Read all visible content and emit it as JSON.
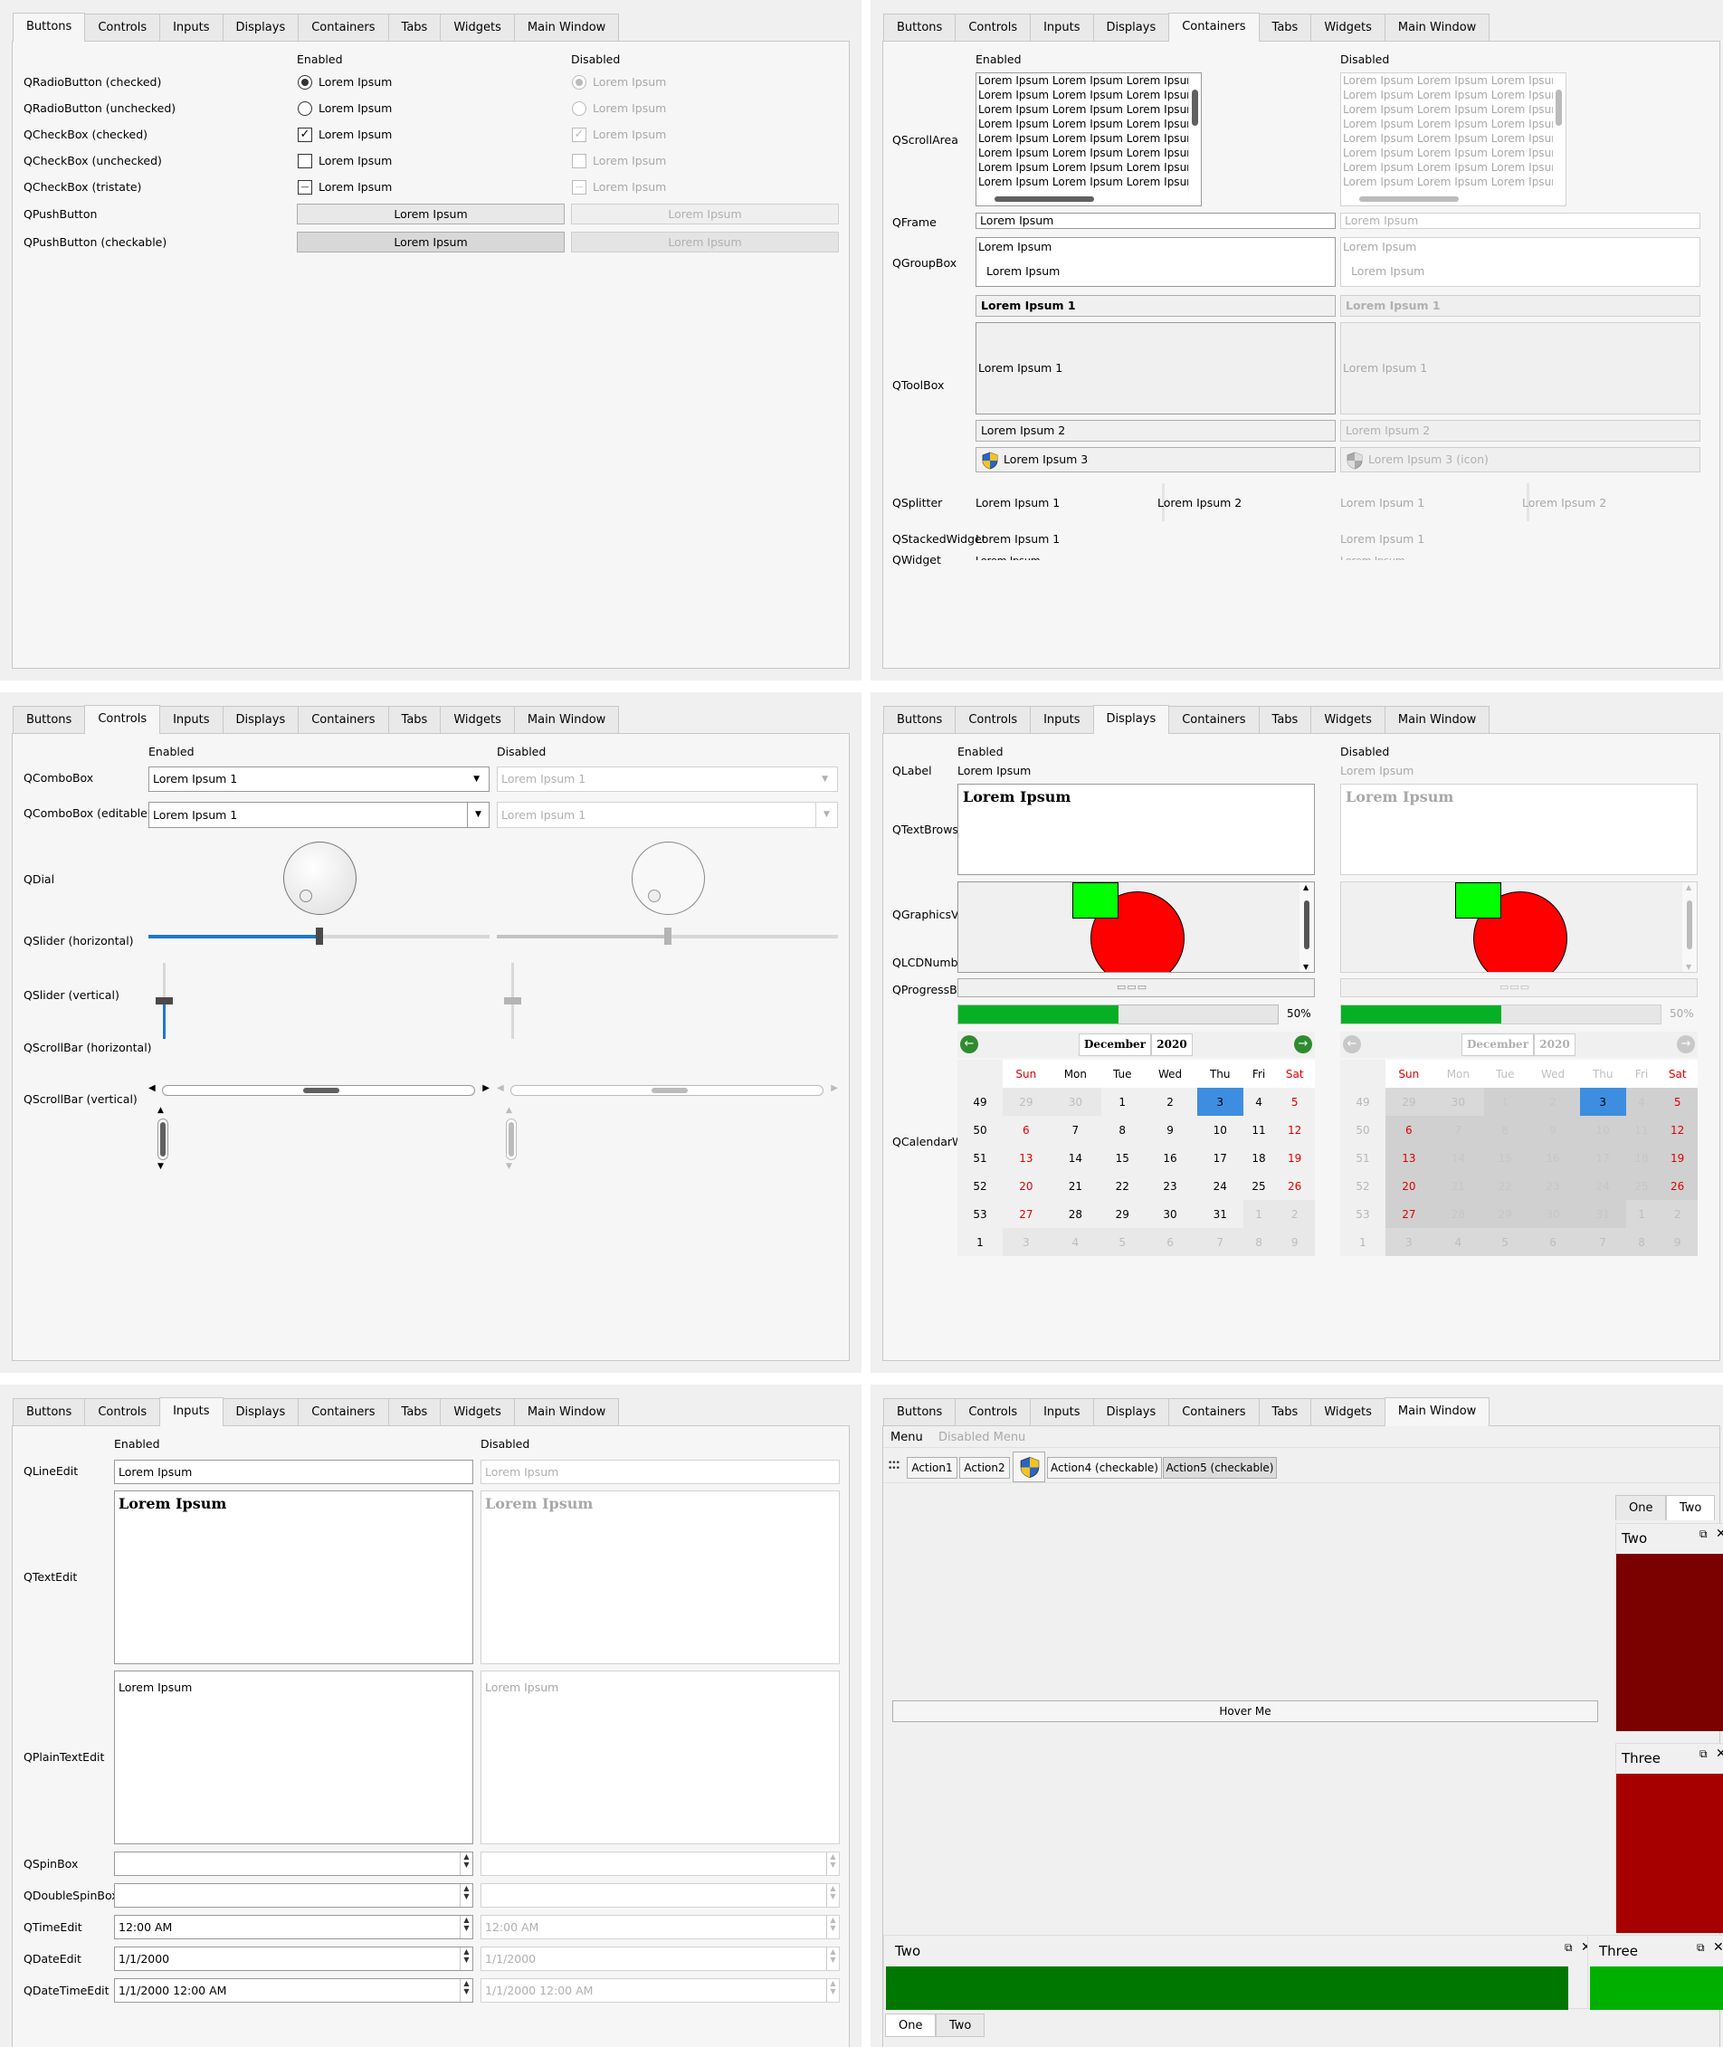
{
  "tabs": [
    "Buttons",
    "Controls",
    "Inputs",
    "Displays",
    "Containers",
    "Tabs",
    "Widgets",
    "Main Window"
  ],
  "headers": {
    "enabled": "Enabled",
    "disabled": "Disabled"
  },
  "buttons": {
    "rows": [
      "QRadioButton (checked)",
      "QRadioButton (unchecked)",
      "QCheckBox (checked)",
      "QCheckBox (unchecked)",
      "QCheckBox (tristate)",
      "QPushButton",
      "QPushButton (checkable)"
    ],
    "text": "Lorem Ipsum",
    "check_mark": "✓",
    "tri_mark": "—"
  },
  "containers": {
    "rows": {
      "scroll": "QScrollArea",
      "frame": "QFrame",
      "group": "QGroupBox",
      "toolbox": "QToolBox",
      "splitter": "QSplitter",
      "stacked": "QStackedWidget",
      "widget": "QWidget"
    },
    "scroll_line": "Lorem Ipsum Lorem Ipsum Lorem Ipsum",
    "text": "Lorem Ipsum",
    "tb1": "Lorem Ipsum 1",
    "tb2": "Lorem Ipsum 2",
    "tb3": "Lorem Ipsum 3",
    "tb3_dis": "Lorem Ipsum 3 (icon)"
  },
  "controls": {
    "rows": [
      "QComboBox",
      "QComboBox (editable)",
      "QDial",
      "QSlider (horizontal)",
      "QSlider (vertical)",
      "QScrollBar (horizontal)",
      "QScrollBar (vertical)"
    ],
    "combo_value": "Lorem Ipsum 1",
    "slider_value": 0.5
  },
  "displays": {
    "rows": {
      "label": "QLabel",
      "browser": "QTextBrowser",
      "graphics": "QGraphicsView",
      "lcd": "QLCDNumber",
      "progress": "QProgressBar",
      "calendar": "QCalendarWidget"
    },
    "label_text": "Lorem Ipsum",
    "browser_text": "Lorem Ipsum",
    "progress_value": 50,
    "progress_text": "50%",
    "month": "December",
    "year": "2020",
    "days": [
      "Sun",
      "Mon",
      "Tue",
      "Wed",
      "Thu",
      "Fri",
      "Sat"
    ],
    "weeks": [
      "49",
      "50",
      "51",
      "52",
      "53",
      "1"
    ],
    "dates": [
      [
        "29",
        "30",
        "1",
        "2",
        "3",
        "4",
        "5"
      ],
      [
        "6",
        "7",
        "8",
        "9",
        "10",
        "11",
        "12"
      ],
      [
        "13",
        "14",
        "15",
        "16",
        "17",
        "18",
        "19"
      ],
      [
        "20",
        "21",
        "22",
        "23",
        "24",
        "25",
        "26"
      ],
      [
        "27",
        "28",
        "29",
        "30",
        "31",
        "1",
        "2"
      ],
      [
        "3",
        "4",
        "5",
        "6",
        "7",
        "8",
        "9"
      ]
    ],
    "selected": "3",
    "colors": {
      "progress": "#06b025",
      "selected": "#3d8ee0",
      "circle": "#ff0000",
      "square": "#00ff00"
    }
  },
  "inputs": {
    "rows": {
      "line": "QLineEdit",
      "text": "QTextEdit",
      "plain": "QPlainTextEdit",
      "spin": "QSpinBox",
      "dspin": "QDoubleSpinBox",
      "time": "QTimeEdit",
      "date": "QDateEdit",
      "datetime": "QDateTimeEdit"
    },
    "line_value": "Lorem Ipsum",
    "text_value": "Lorem Ipsum",
    "plain_value": "Lorem Ipsum",
    "time_value": "12:00 AM",
    "date_value": "1/1/2000",
    "datetime_value": "1/1/2000 12:00 AM"
  },
  "mainwindow": {
    "menu": "Menu",
    "menu_disabled": "Disabled Menu",
    "actions": [
      "Action1",
      "Action2",
      "Action4 (checkable)",
      "Action5 (checkable)"
    ],
    "hover": "Hover Me",
    "dock_tabs": [
      "One",
      "Two"
    ],
    "dock_two": "Two",
    "dock_three": "Three",
    "colors": {
      "two_red": "#7b0000",
      "three_red": "#a60000",
      "green_dark": "#007800",
      "green_light": "#00b000"
    }
  }
}
